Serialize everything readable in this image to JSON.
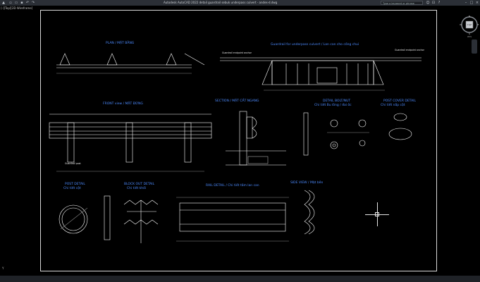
{
  "app": {
    "window_title": "Autodesk AutoCAD 2022   detail guardrail sebuk underpass culvert - andes-d.dwg",
    "search_placeholder": "Type a keyword or phrase",
    "view_label": "[-][Top][2D Wireframe]"
  },
  "viewcube": {
    "top": "TOP",
    "n": "N",
    "s": "S",
    "e": "E",
    "w": "W",
    "wcs": "WCS"
  },
  "drawing": {
    "plan_title": "PLAN / MẶT BẰNG",
    "culvert_title": "Guardrail for underpass culvert / Lan can cho cống chui",
    "culvert_note_left": "Guardrail endpoint anchor",
    "culvert_note_right": "Guardrail endpoint anchor",
    "front_title": "FRONT view / MẶT ĐỨNG",
    "section_title": "SECTION / MẶT CẮT NGANG",
    "detail_bolt_title": "DETAIL BOLT/NUT",
    "detail_bolt_sub": "Chi tiết Bu lông / đai ốc",
    "post_cover_title": "POST COVER DETAIL",
    "post_cover_sub": "Chi tiết nắp cột",
    "post_detail_title": "POST DETAIL",
    "post_detail_sub": "Chi tiết cột",
    "block_out_title": "BLOCK OUT DETAIL",
    "block_out_sub": "Chi tiết khối",
    "rail_detail_title": "RAIL DETAIL / Chi tiết tấm lan can",
    "side_view_title": "SIDE VIEW / Mặt bên",
    "front_note": "Guardrail post"
  },
  "ucs_label": "Y"
}
